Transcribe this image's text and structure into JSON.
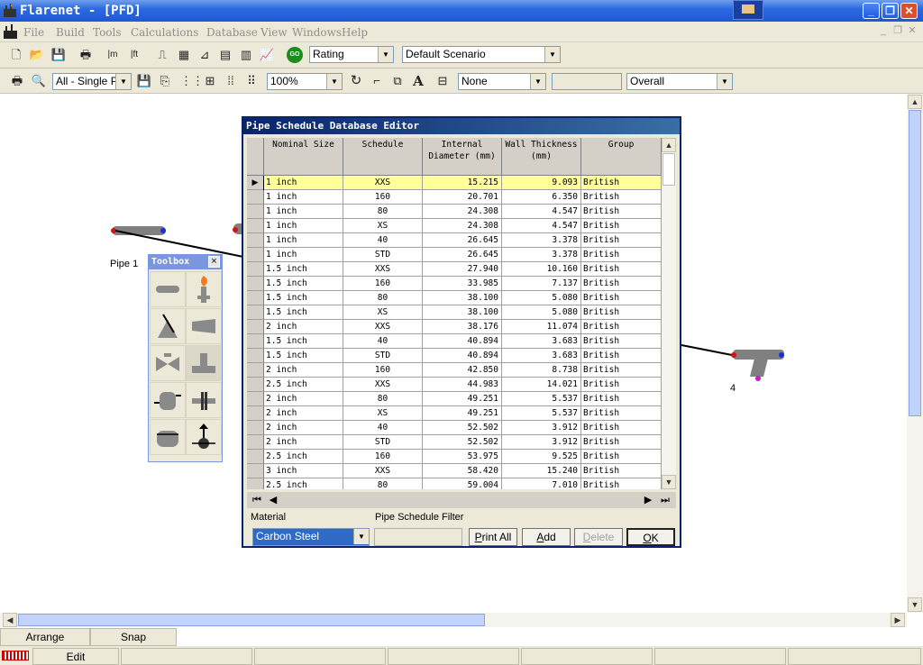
{
  "window": {
    "title": "Flarenet - [PFD]"
  },
  "menu": [
    "File",
    "Build",
    "Tools",
    "Calculations",
    "Database",
    "View",
    "Windows",
    "Help"
  ],
  "toolbar1": {
    "mode_value": "Rating",
    "scenario_value": "Default Scenario"
  },
  "toolbar2": {
    "view_value": "All - Single Pa",
    "zoom_value": "100%",
    "label_value": "None",
    "extra_value": "",
    "overall_value": "Overall"
  },
  "canvas": {
    "pipe1_label": "Pipe 1",
    "node4_label": "4"
  },
  "toolbox": {
    "title": "Toolbox",
    "close": "×"
  },
  "dialog": {
    "title": "Pipe Schedule Database Editor",
    "columns": [
      {
        "label": "Nominal Size"
      },
      {
        "label": "Schedule"
      },
      {
        "label": "Internal Diameter (mm)"
      },
      {
        "label": "Wall Thickness (mm)"
      },
      {
        "label": "Group"
      }
    ],
    "rows": [
      {
        "size": "1 inch",
        "schedule": "XXS",
        "id": "15.215",
        "wall": "9.093",
        "group": "British"
      },
      {
        "size": "1 inch",
        "schedule": "160",
        "id": "20.701",
        "wall": "6.350",
        "group": "British"
      },
      {
        "size": "1 inch",
        "schedule": "80",
        "id": "24.308",
        "wall": "4.547",
        "group": "British"
      },
      {
        "size": "1 inch",
        "schedule": "XS",
        "id": "24.308",
        "wall": "4.547",
        "group": "British"
      },
      {
        "size": "1 inch",
        "schedule": "40",
        "id": "26.645",
        "wall": "3.378",
        "group": "British"
      },
      {
        "size": "1 inch",
        "schedule": "STD",
        "id": "26.645",
        "wall": "3.378",
        "group": "British"
      },
      {
        "size": "1.5 inch",
        "schedule": "XXS",
        "id": "27.940",
        "wall": "10.160",
        "group": "British"
      },
      {
        "size": "1.5 inch",
        "schedule": "160",
        "id": "33.985",
        "wall": "7.137",
        "group": "British"
      },
      {
        "size": "1.5 inch",
        "schedule": "80",
        "id": "38.100",
        "wall": "5.080",
        "group": "British"
      },
      {
        "size": "1.5 inch",
        "schedule": "XS",
        "id": "38.100",
        "wall": "5.080",
        "group": "British"
      },
      {
        "size": "2 inch",
        "schedule": "XXS",
        "id": "38.176",
        "wall": "11.074",
        "group": "British"
      },
      {
        "size": "1.5 inch",
        "schedule": "40",
        "id": "40.894",
        "wall": "3.683",
        "group": "British"
      },
      {
        "size": "1.5 inch",
        "schedule": "STD",
        "id": "40.894",
        "wall": "3.683",
        "group": "British"
      },
      {
        "size": "2 inch",
        "schedule": "160",
        "id": "42.850",
        "wall": "8.738",
        "group": "British"
      },
      {
        "size": "2.5 inch",
        "schedule": "XXS",
        "id": "44.983",
        "wall": "14.021",
        "group": "British"
      },
      {
        "size": "2 inch",
        "schedule": "80",
        "id": "49.251",
        "wall": "5.537",
        "group": "British"
      },
      {
        "size": "2 inch",
        "schedule": "XS",
        "id": "49.251",
        "wall": "5.537",
        "group": "British"
      },
      {
        "size": "2 inch",
        "schedule": "40",
        "id": "52.502",
        "wall": "3.912",
        "group": "British"
      },
      {
        "size": "2 inch",
        "schedule": "STD",
        "id": "52.502",
        "wall": "3.912",
        "group": "British"
      },
      {
        "size": "2.5 inch",
        "schedule": "160",
        "id": "53.975",
        "wall": "9.525",
        "group": "British"
      },
      {
        "size": "3 inch",
        "schedule": "XXS",
        "id": "58.420",
        "wall": "15.240",
        "group": "British"
      },
      {
        "size": "2.5 inch",
        "schedule": "80",
        "id": "59.004",
        "wall": "7.010",
        "group": "British"
      }
    ],
    "material_label": "Material",
    "material_value": "Carbon Steel",
    "filter_label": "Pipe Schedule Filter",
    "filter_value": "",
    "buttons": {
      "print_all": "Print All",
      "add": "Add",
      "delete": "Delete",
      "ok": "OK"
    }
  },
  "tabs": {
    "arrange": "Arrange",
    "snap": "Snap"
  },
  "status": {
    "mode": "Edit"
  },
  "colors": {
    "titlebar": "#2d6ae0",
    "selected_row": "#ffff99",
    "dialog_title": "#0a246a"
  }
}
